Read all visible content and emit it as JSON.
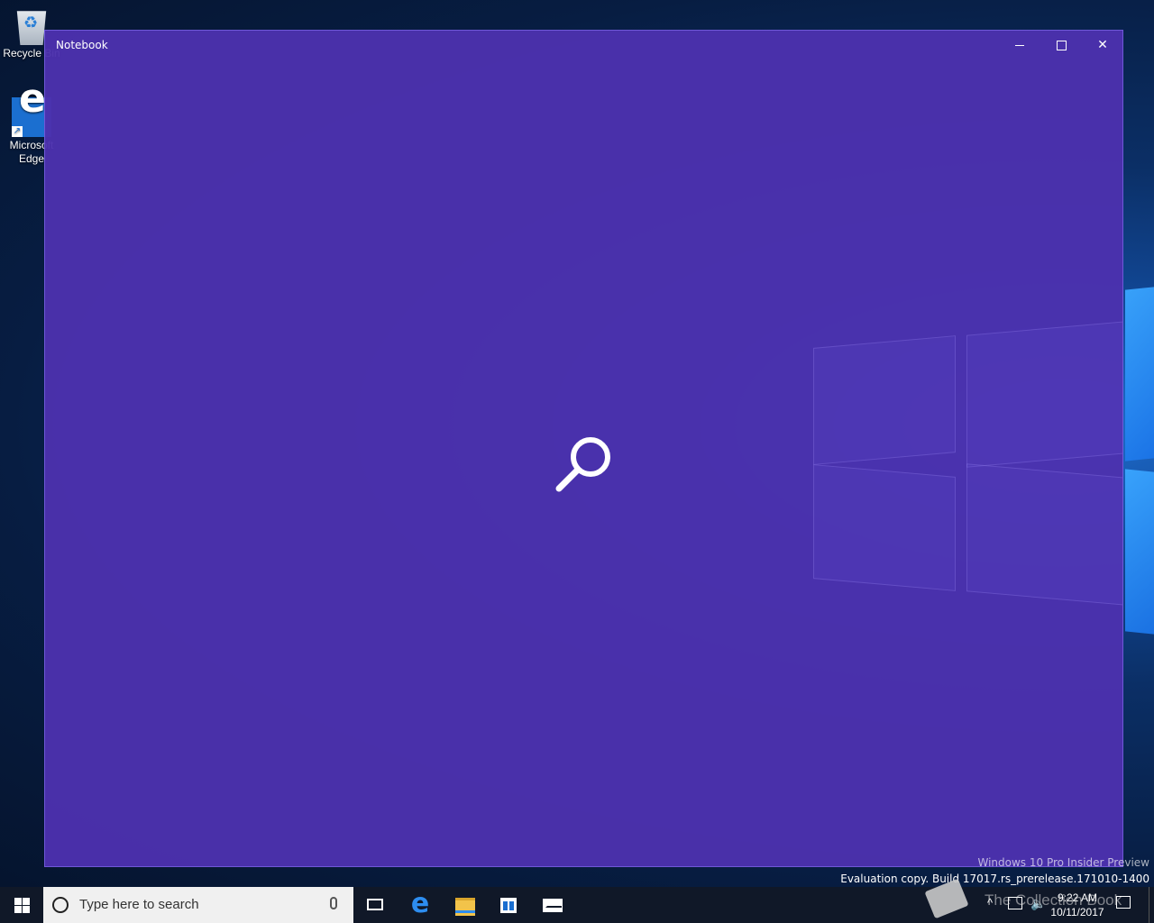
{
  "desktop": {
    "icons": [
      {
        "label": "Recycle Bin",
        "icon": "recycle-bin-icon"
      },
      {
        "label": "Microsoft Edge",
        "icon": "edge-icon"
      }
    ]
  },
  "window": {
    "title": "Notebook",
    "state": "loading",
    "loading_icon": "search-icon",
    "background_color": "#4c31ae"
  },
  "watermark": {
    "line1": "Windows 10 Pro Insider Preview",
    "line2": "Evaluation copy. Build 17017.rs_prerelease.171010-1400"
  },
  "taskbar": {
    "search_placeholder": "Type here to search",
    "apps": [
      "task-view-icon",
      "edge-icon",
      "file-explorer-icon",
      "store-icon",
      "mail-icon"
    ],
    "clock_time": "9:22 AM",
    "clock_date": "10/11/2017"
  },
  "overlay_watermark": {
    "text": "The Collection Book"
  }
}
